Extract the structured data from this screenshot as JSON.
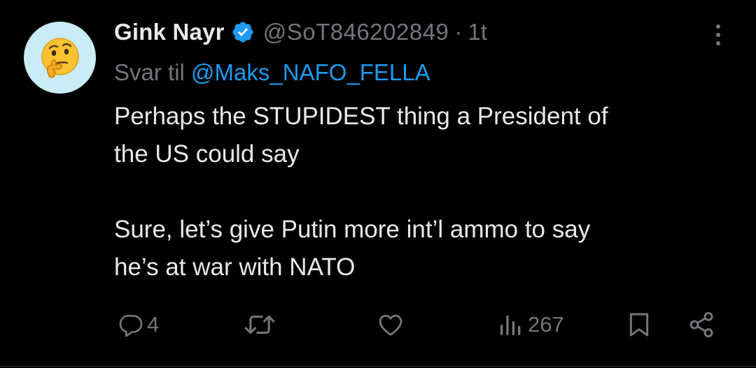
{
  "author": {
    "display_name": "Gink Nayr",
    "handle": "@SoT846202849",
    "separator": "·",
    "time": "1t",
    "verified": true,
    "avatar_icon": "thinking-face-emoji"
  },
  "reply": {
    "prefix": "Svar til",
    "mention": "@Maks_NAFO_FELLA"
  },
  "body": {
    "paragraph_1_line_1": "Perhaps the STUPIDEST thing a President of",
    "paragraph_1_line_2": "the US could say",
    "paragraph_2_line_1": "Sure, let’s give Putin more int’l ammo to say",
    "paragraph_2_line_2": "he’s at war with NATO"
  },
  "actions": {
    "reply_count": "4",
    "retweet_count": "",
    "like_count": "",
    "views_count": "267"
  },
  "icons": {
    "reply": "reply-icon",
    "retweet": "retweet-icon",
    "like": "heart-icon",
    "views": "views-icon",
    "bookmark": "bookmark-icon",
    "share": "share-icon",
    "more": "more-dots-icon",
    "verified": "verified-badge-icon"
  },
  "colors": {
    "background": "#000000",
    "primary_text": "#e7e9ea",
    "secondary_text": "#71767b",
    "link": "#1d9bf0",
    "verified_badge": "#1d9bf0",
    "avatar_bg": "#c9ecf6"
  }
}
